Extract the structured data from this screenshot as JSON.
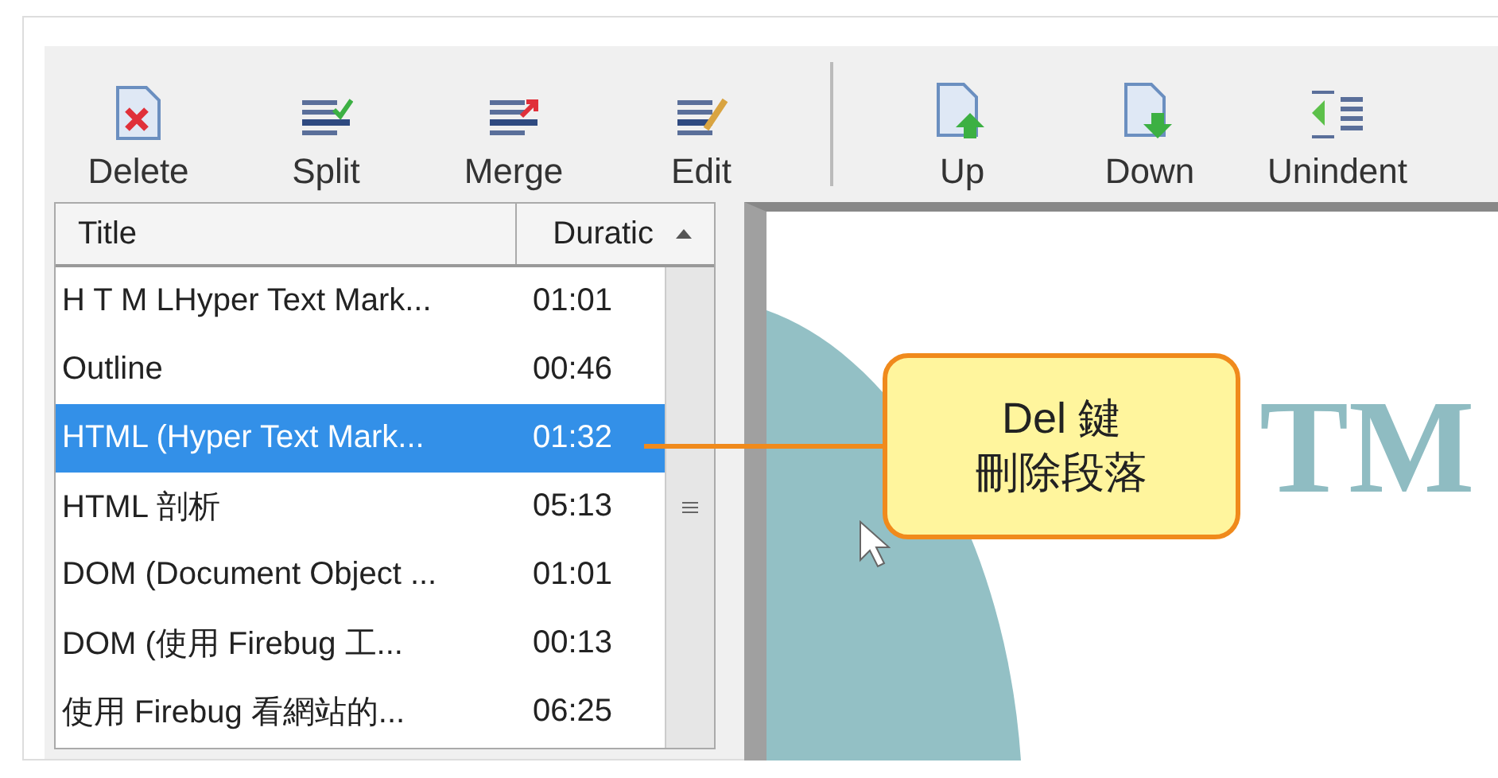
{
  "toolbar": {
    "groups": [
      [
        {
          "label": "Delete"
        },
        {
          "label": "Split"
        },
        {
          "label": "Merge"
        },
        {
          "label": "Edit"
        }
      ],
      [
        {
          "label": "Up"
        },
        {
          "label": "Down"
        },
        {
          "label": "Unindent"
        }
      ]
    ]
  },
  "list": {
    "columns": [
      "Title",
      "Duratic"
    ],
    "rows": [
      {
        "title": "H T M LHyper Text Mark...",
        "duration": "01:01",
        "selected": false
      },
      {
        "title": "Outline",
        "duration": "00:46",
        "selected": false
      },
      {
        "title": "HTML (Hyper Text Mark...",
        "duration": "01:32",
        "selected": true
      },
      {
        "title": "HTML 剖析",
        "duration": "05:13",
        "selected": false
      },
      {
        "title": "DOM (Document Object ...",
        "duration": "01:01",
        "selected": false
      },
      {
        "title": "DOM (使用 Firebug 工...",
        "duration": "00:13",
        "selected": false
      },
      {
        "title": "使用 Firebug 看網站的...",
        "duration": "06:25",
        "selected": false
      }
    ]
  },
  "preview": {
    "slide_text": "TM"
  },
  "callout": {
    "lines": [
      "Del 鍵",
      "刪除段落"
    ]
  }
}
